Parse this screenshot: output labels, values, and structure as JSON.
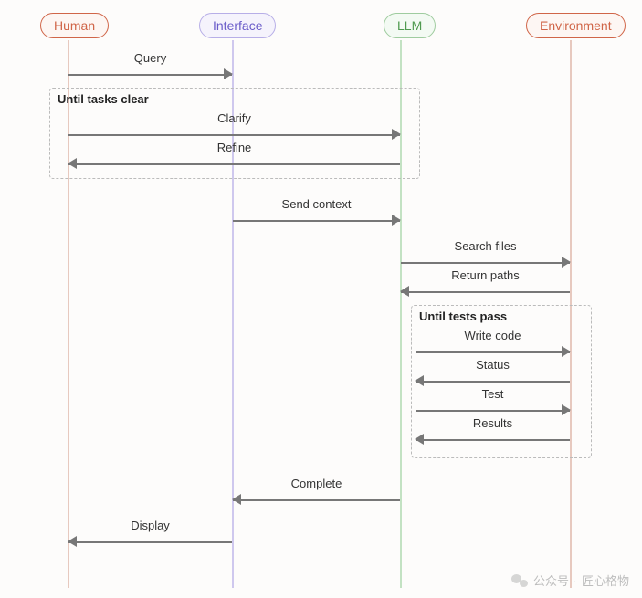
{
  "actors": {
    "human": "Human",
    "interface": "Interface",
    "llm": "LLM",
    "environment": "Environment"
  },
  "frames": {
    "clarify_loop": "Until tasks clear",
    "test_loop": "Until tests pass"
  },
  "messages": {
    "query": "Query",
    "clarify": "Clarify",
    "refine": "Refine",
    "send_context": "Send context",
    "search_files": "Search files",
    "return_paths": "Return paths",
    "write_code": "Write code",
    "status": "Status",
    "test": "Test",
    "results": "Results",
    "complete": "Complete",
    "display": "Display"
  },
  "watermark": {
    "prefix": "公众号 ·",
    "name": "匠心格物"
  },
  "chart_data": {
    "type": "sequence-diagram",
    "participants": [
      "Human",
      "Interface",
      "LLM",
      "Environment"
    ],
    "steps": [
      {
        "from": "Human",
        "to": "Interface",
        "label": "Query"
      },
      {
        "loop": "Until tasks clear",
        "steps": [
          {
            "from": "Human",
            "to": "LLM",
            "label": "Clarify"
          },
          {
            "from": "LLM",
            "to": "Human",
            "label": "Refine"
          }
        ]
      },
      {
        "from": "Interface",
        "to": "LLM",
        "label": "Send context"
      },
      {
        "from": "LLM",
        "to": "Environment",
        "label": "Search files"
      },
      {
        "from": "Environment",
        "to": "LLM",
        "label": "Return paths"
      },
      {
        "loop": "Until tests pass",
        "steps": [
          {
            "from": "LLM",
            "to": "Environment",
            "label": "Write code"
          },
          {
            "from": "Environment",
            "to": "LLM",
            "label": "Status"
          },
          {
            "from": "LLM",
            "to": "Environment",
            "label": "Test"
          },
          {
            "from": "Environment",
            "to": "LLM",
            "label": "Results"
          }
        ]
      },
      {
        "from": "LLM",
        "to": "Interface",
        "label": "Complete"
      },
      {
        "from": "Interface",
        "to": "Human",
        "label": "Display"
      }
    ]
  }
}
